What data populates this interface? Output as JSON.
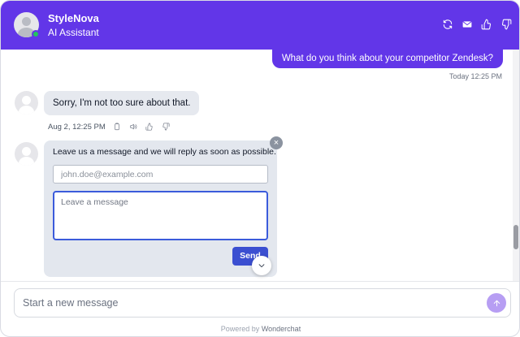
{
  "header": {
    "title": "StyleNova",
    "subtitle": "AI Assistant",
    "status": "online",
    "actions": [
      {
        "name": "refresh-icon"
      },
      {
        "name": "mail-icon"
      },
      {
        "name": "thumbs-up-icon"
      },
      {
        "name": "thumbs-down-icon"
      }
    ]
  },
  "messages": {
    "user": {
      "text": "What do you think about your competitor Zendesk?",
      "time": "Today 12:25 PM"
    },
    "bot": {
      "text": "Sorry, I'm not too sure about that.",
      "time": "Aug 2, 12:25 PM",
      "actions": [
        "copy-icon",
        "speaker-icon",
        "thumbs-up-icon",
        "thumbs-down-icon"
      ]
    }
  },
  "lead_form": {
    "prompt": "Leave us a message and we will reply as soon as possible.",
    "email_placeholder": "john.doe@example.com",
    "email_value": "",
    "message_placeholder": "Leave a message",
    "message_value": "",
    "send_label": "Send",
    "close_glyph": "×"
  },
  "composer": {
    "placeholder": "Start a new message",
    "value": ""
  },
  "footer": {
    "powered_prefix": "Powered by",
    "powered_brand": "Wonderchat"
  },
  "colors": {
    "brand": "#6236e8",
    "send_button": "#3b4fd1",
    "composer_send": "#b79ef3",
    "online": "#22c55e",
    "bot_bubble": "#e6e9ef"
  }
}
